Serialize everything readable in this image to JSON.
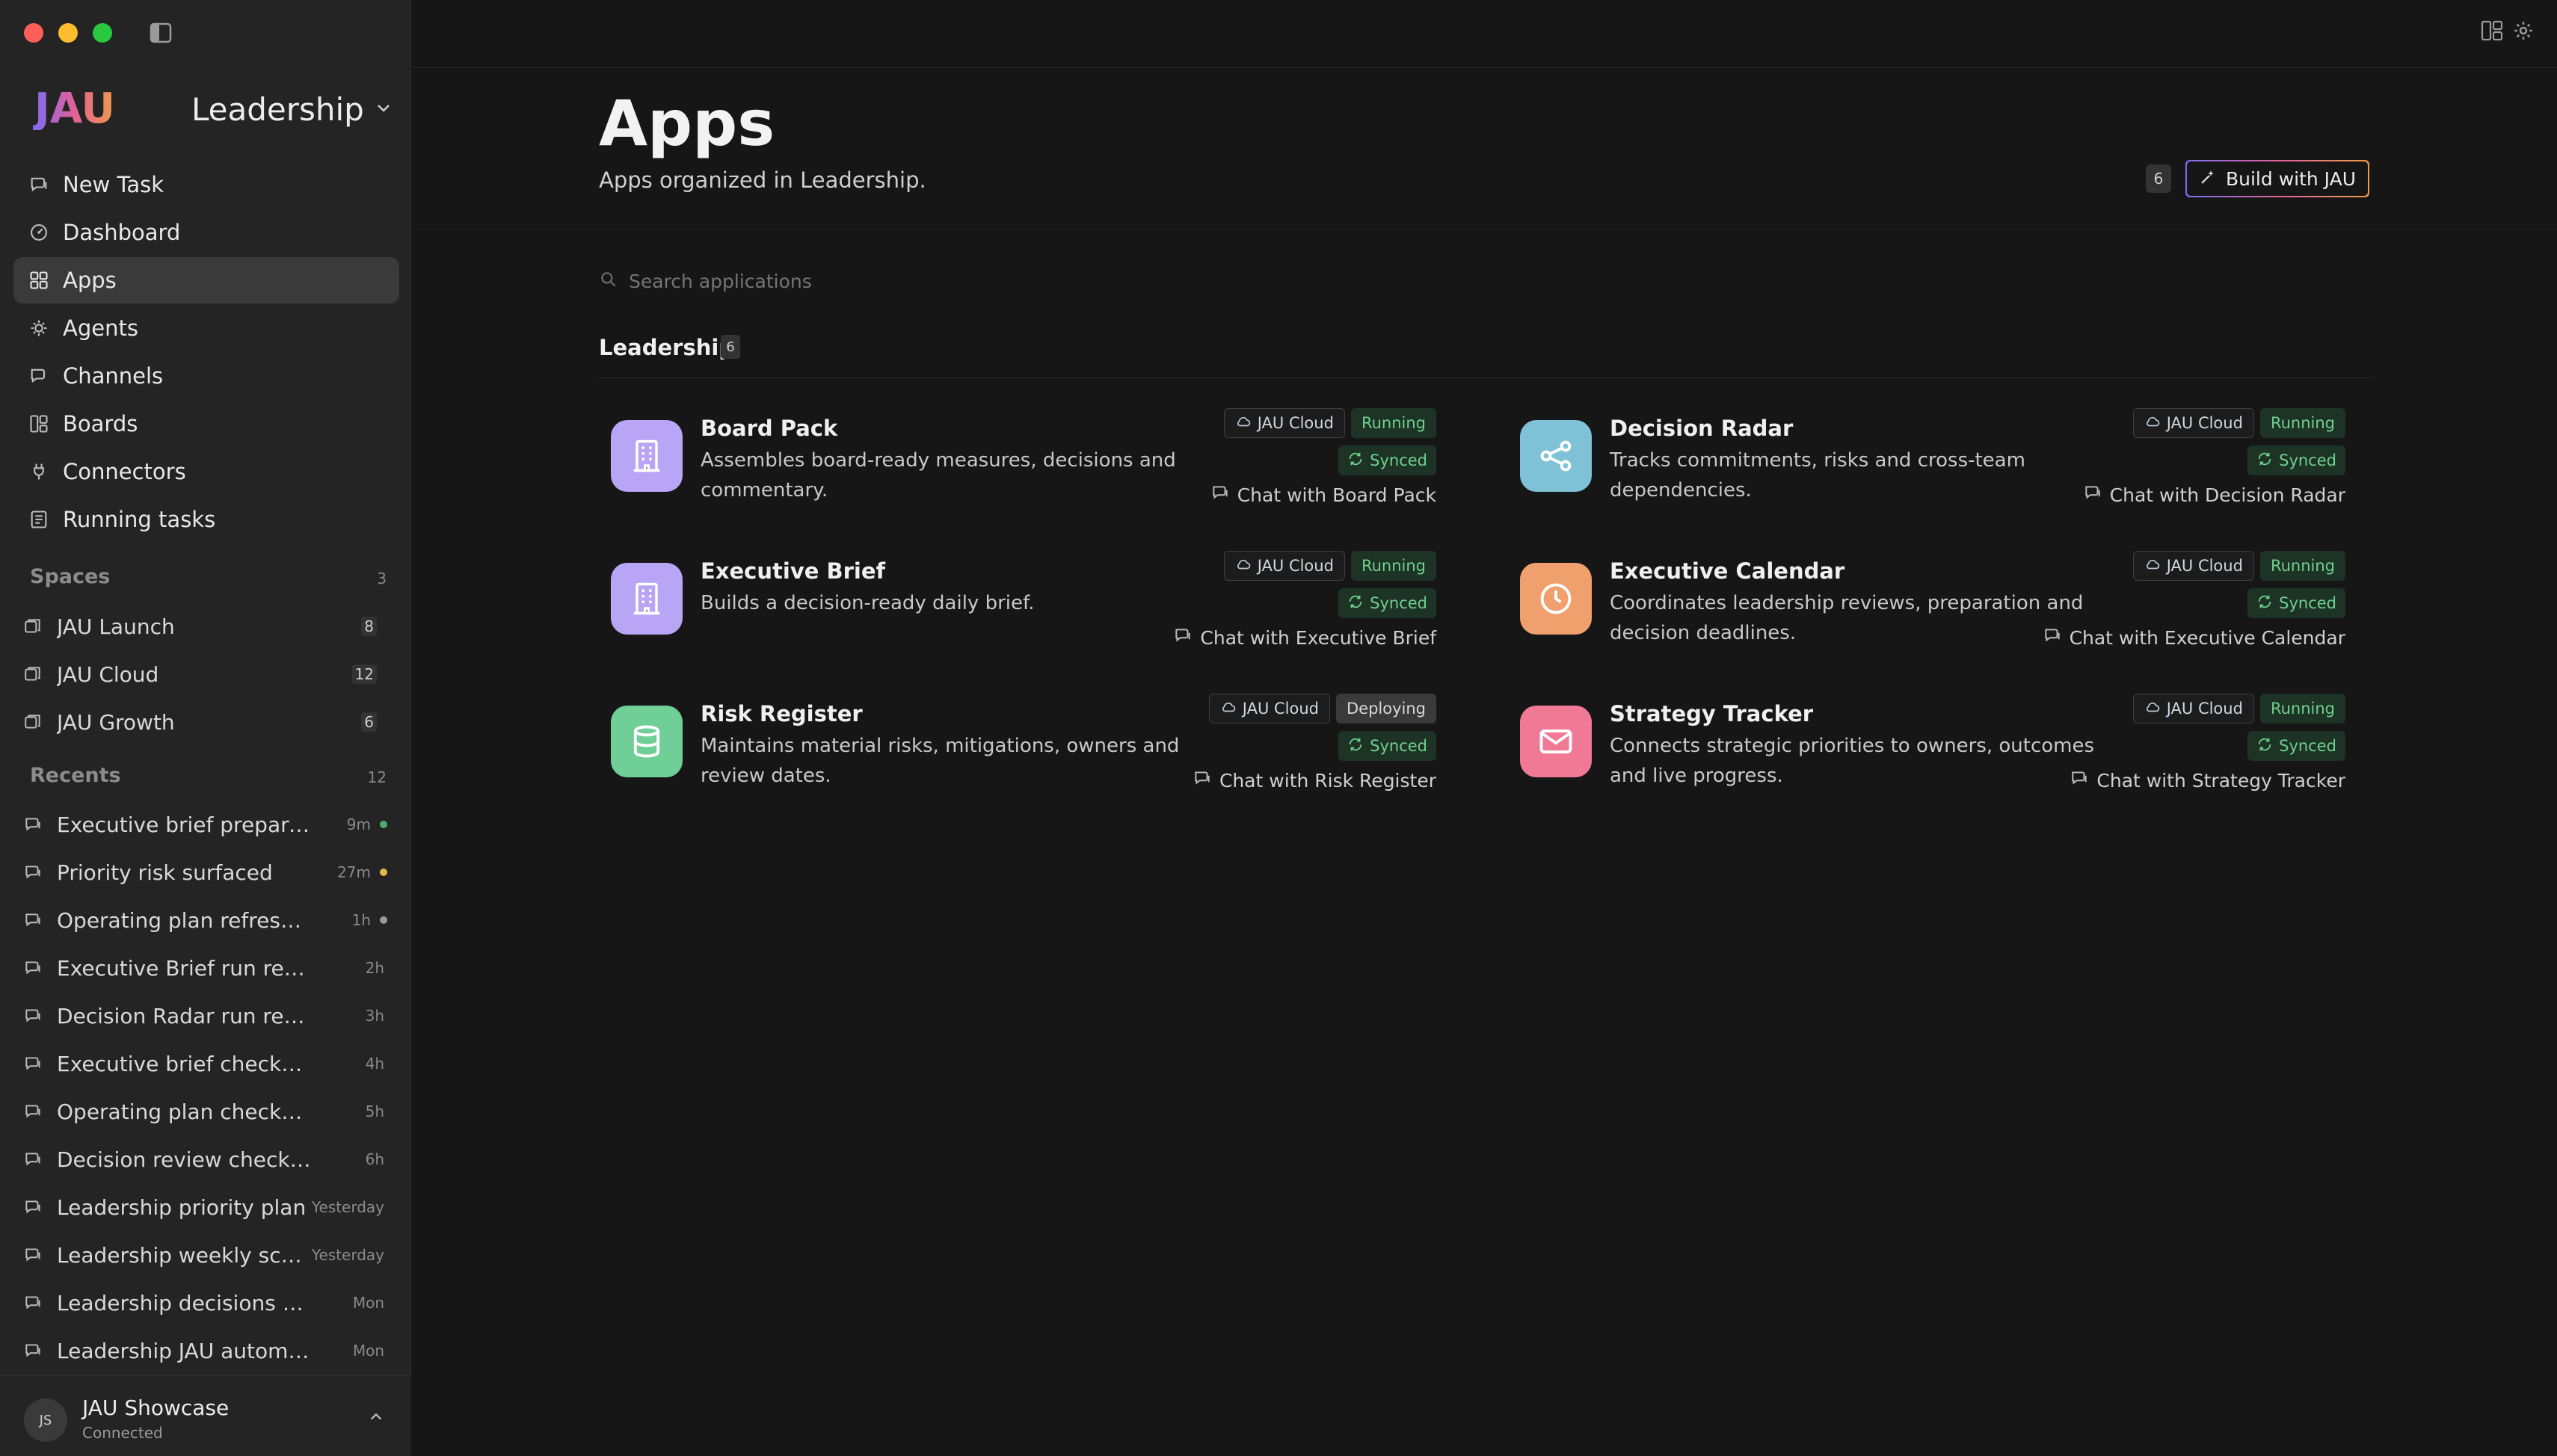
{
  "window": {
    "title": "Leadership"
  },
  "sidebar": {
    "logo": "JAU",
    "workspace": "Leadership",
    "nav": [
      {
        "label": "New Task",
        "icon": "chat-icon"
      },
      {
        "label": "Dashboard",
        "icon": "dashboard-icon"
      },
      {
        "label": "Apps",
        "icon": "apps-icon",
        "active": true
      },
      {
        "label": "Agents",
        "icon": "agent-icon"
      },
      {
        "label": "Channels",
        "icon": "channels-icon"
      },
      {
        "label": "Boards",
        "icon": "boards-icon"
      },
      {
        "label": "Connectors",
        "icon": "plug-icon"
      },
      {
        "label": "Running tasks",
        "icon": "tasks-icon"
      }
    ],
    "spaces": {
      "label": "Spaces",
      "count": "3",
      "items": [
        {
          "label": "JAU Launch",
          "count": "8"
        },
        {
          "label": "JAU Cloud",
          "count": "12"
        },
        {
          "label": "JAU Growth",
          "count": "6"
        }
      ]
    },
    "recents": {
      "label": "Recents",
      "count": "12",
      "items": [
        {
          "label": "Executive brief prepared",
          "time": "9m",
          "dot": "#4caf6e"
        },
        {
          "label": "Priority risk surfaced",
          "time": "27m",
          "dot": "#e8b84a"
        },
        {
          "label": "Operating plan refreshed",
          "time": "1h",
          "dot": "#9a9a9a"
        },
        {
          "label": "Executive Brief run review",
          "time": "2h"
        },
        {
          "label": "Decision Radar run review",
          "time": "3h"
        },
        {
          "label": "Executive brief checkpoint",
          "time": "4h"
        },
        {
          "label": "Operating plan checkpoint",
          "time": "5h"
        },
        {
          "label": "Decision review checkpoint",
          "time": "6h"
        },
        {
          "label": "Leadership priority plan",
          "time": "Yesterday"
        },
        {
          "label": "Leadership weekly sco...",
          "time": "Yesterday"
        },
        {
          "label": "Leadership decisions and ...",
          "time": "Mon"
        },
        {
          "label": "Leadership JAU automation...",
          "time": "Mon"
        }
      ]
    },
    "user": {
      "initials": "JS",
      "name": "JAU Showcase",
      "status": "Connected"
    }
  },
  "header": {
    "title": "Apps",
    "subtitle": "Apps organized in Leadership.",
    "count": "6",
    "build_button": "Build with JAU"
  },
  "search": {
    "placeholder": "Search applications"
  },
  "group": {
    "label": "Leadership",
    "count": "6"
  },
  "apps": [
    {
      "name": "Board Pack",
      "desc": "Assembles board-ready measures, decisions and commentary.",
      "host": "JAU Cloud",
      "status": "Running",
      "sync": "Synced",
      "chat": "Chat with Board Pack",
      "icon": "building-icon",
      "color": "#b9a5f5"
    },
    {
      "name": "Decision Radar",
      "desc": "Tracks commitments, risks and cross-team dependencies.",
      "host": "JAU Cloud",
      "status": "Running",
      "sync": "Synced",
      "chat": "Chat with Decision Radar",
      "icon": "share-icon",
      "color": "#7fc1d6"
    },
    {
      "name": "Executive Brief",
      "desc": "Builds a decision-ready daily brief.",
      "host": "JAU Cloud",
      "status": "Running",
      "sync": "Synced",
      "chat": "Chat with Executive Brief",
      "icon": "building-icon",
      "color": "#b9a5f5"
    },
    {
      "name": "Executive Calendar",
      "desc": "Coordinates leadership reviews, preparation and decision deadlines.",
      "host": "JAU Cloud",
      "status": "Running",
      "sync": "Synced",
      "chat": "Chat with Executive Calendar",
      "icon": "clock-icon",
      "color": "#f0a06d"
    },
    {
      "name": "Risk Register",
      "desc": "Maintains material risks, mitigations, owners and review dates.",
      "host": "JAU Cloud",
      "status": "Deploying",
      "sync": "Synced",
      "chat": "Chat with Risk Register",
      "icon": "database-icon",
      "color": "#6fcf97"
    },
    {
      "name": "Strategy Tracker",
      "desc": "Connects strategic priorities to owners, outcomes and live progress.",
      "host": "JAU Cloud",
      "status": "Running",
      "sync": "Synced",
      "chat": "Chat with Strategy Tracker",
      "icon": "mail-icon",
      "color": "#f07a95"
    }
  ]
}
